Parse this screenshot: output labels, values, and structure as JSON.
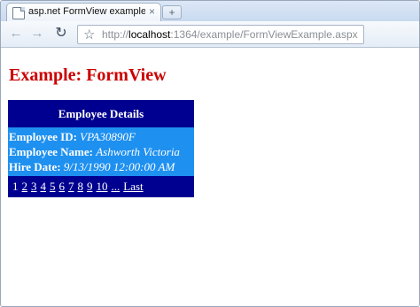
{
  "browser": {
    "tab_title": "asp.net FormView example...",
    "tab_close": "×",
    "new_tab": "+",
    "url_scheme": "http://",
    "url_host": "localhost",
    "url_path": ":1364/example/FormViewExample.aspx"
  },
  "page": {
    "heading": "Example: FormView"
  },
  "formview": {
    "header": "Employee Details",
    "fields": [
      {
        "label": "Employee ID:",
        "value": "VPA30890F"
      },
      {
        "label": "Employee Name:",
        "value": "Ashworth Victoria"
      },
      {
        "label": "Hire Date:",
        "value": "9/13/1990 12:00:00 AM"
      }
    ],
    "pager": {
      "current": "1",
      "pages": [
        "2",
        "3",
        "4",
        "5",
        "6",
        "7",
        "8",
        "9",
        "10"
      ],
      "more": "...",
      "last": "Last"
    }
  }
}
